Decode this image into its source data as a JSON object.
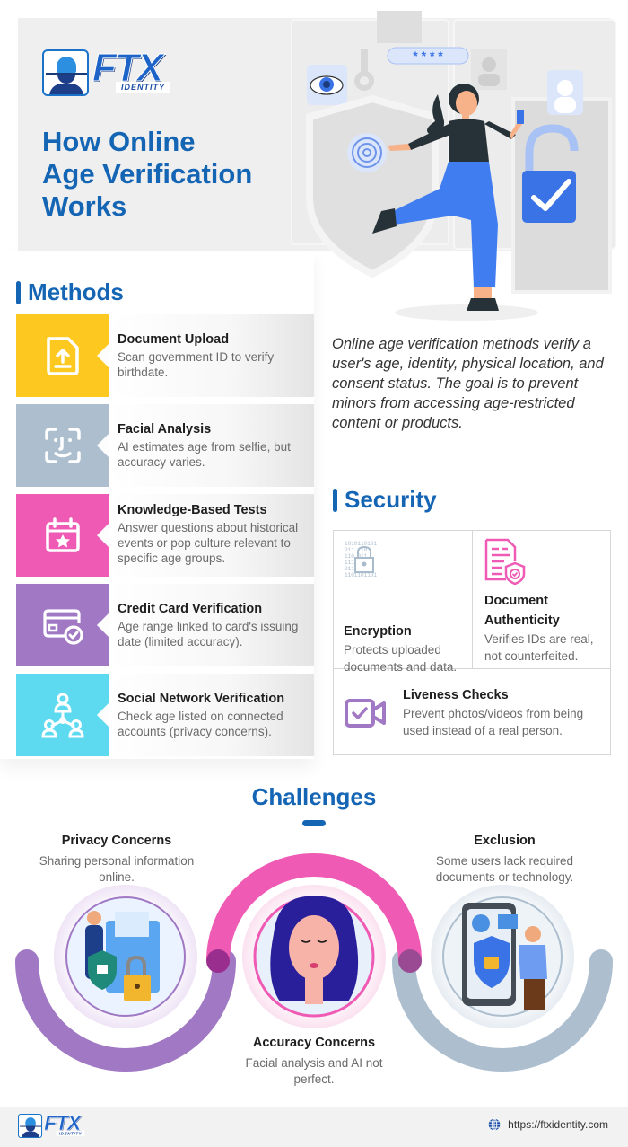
{
  "brand": {
    "name": "FTX",
    "sub": "IDENTITY",
    "primary_color": "#1565b5"
  },
  "hero": {
    "title_lines": [
      "How Online",
      "Age Verification",
      "Works"
    ],
    "illustration": "woman-with-phone-security-shield-lock-icon",
    "password_mask": "* * * *"
  },
  "methods": {
    "heading": "Methods",
    "items": [
      {
        "title": "Document Upload",
        "desc": "Scan government ID to verify birthdate.",
        "icon": "document-upload-icon",
        "color": "#fdc81f"
      },
      {
        "title": "Facial Analysis",
        "desc": "AI estimates age from selfie, but accuracy varies.",
        "icon": "face-scan-icon",
        "color": "#adbfcf"
      },
      {
        "title": "Knowledge-Based Tests",
        "desc": "Answer questions about historical events or pop culture relevant to specific age groups.",
        "icon": "calendar-star-icon",
        "color": "#ef5ab4"
      },
      {
        "title": "Credit Card Verification",
        "desc": "Age range linked to card's issuing date (limited accuracy).",
        "icon": "credit-card-check-icon",
        "color": "#a078c4"
      },
      {
        "title": "Social Network Verification",
        "desc": "Check age listed on connected accounts (privacy concerns).",
        "icon": "social-network-icon",
        "color": "#5ddaf0"
      }
    ]
  },
  "intro": "Online age verification methods verify a user's age, identity, physical location, and consent status. The goal is to prevent minors from accessing age-restricted content or products.",
  "security": {
    "heading": "Security",
    "items": [
      {
        "title": "Encryption",
        "desc": "Protects uploaded documents and data.",
        "icon": "encryption-lock-icon"
      },
      {
        "title": "Document Authenticity",
        "desc": "Verifies IDs are real, not counterfeited.",
        "icon": "document-shield-icon"
      },
      {
        "title": "Liveness Checks",
        "desc": "Prevent photos/videos from being used instead of a real person.",
        "icon": "video-check-icon"
      }
    ]
  },
  "challenges": {
    "heading": "Challenges",
    "items": [
      {
        "title": "Privacy Concerns",
        "desc": "Sharing personal information online.",
        "color": "#a078c4"
      },
      {
        "title": "Accuracy Concerns",
        "desc": "Facial analysis and AI not perfect.",
        "color": "#ef5ab4"
      },
      {
        "title": "Exclusion",
        "desc": "Some users lack required documents or technology.",
        "color": "#adbfcf"
      }
    ]
  },
  "footer": {
    "url": "https://ftxidentity.com"
  }
}
